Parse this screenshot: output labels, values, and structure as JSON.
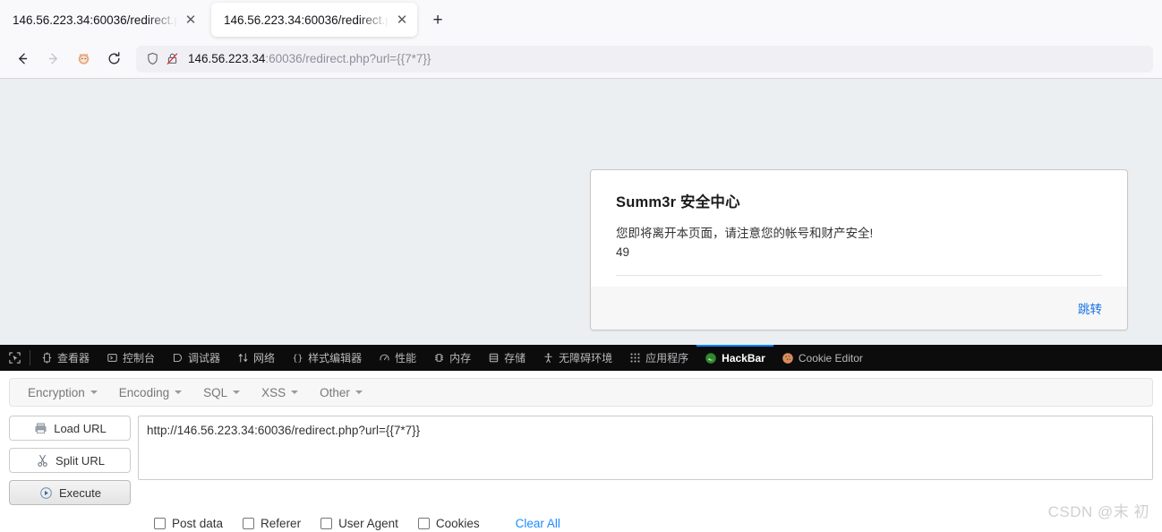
{
  "browser": {
    "tabs": [
      {
        "title": "146.56.223.34:60036/redirect.php",
        "active": false,
        "close": "✕"
      },
      {
        "title": "146.56.223.34:60036/redirect.php",
        "active": true,
        "close": "✕"
      }
    ],
    "newtab_label": "+",
    "nav": {
      "back": "←",
      "forward": "→",
      "home_icon": "fox-home-icon",
      "reload": "↻"
    },
    "urlbar": {
      "shield_icon": "shield-icon",
      "lock_icon": "lock-crossed-icon",
      "url_host": "146.56.223.34",
      "url_rest": ":60036/redirect.php?url={{7*7}}"
    }
  },
  "page": {
    "card": {
      "title": "Summ3r 安全中心",
      "message": "您即将离开本页面，请注意您的帐号和财产安全!",
      "result": "49",
      "link": "跳转"
    },
    "background_color": "#eceff1"
  },
  "devtools": {
    "picker_icon": "element-picker-icon",
    "tabs": [
      {
        "label": "查看器",
        "icon": "inspector-icon",
        "active": false
      },
      {
        "label": "控制台",
        "icon": "console-icon",
        "active": false
      },
      {
        "label": "调试器",
        "icon": "debugger-icon",
        "active": false
      },
      {
        "label": "网络",
        "icon": "network-icon",
        "active": false
      },
      {
        "label": "样式编辑器",
        "icon": "style-editor-icon",
        "active": false
      },
      {
        "label": "性能",
        "icon": "performance-icon",
        "active": false
      },
      {
        "label": "内存",
        "icon": "memory-icon",
        "active": false
      },
      {
        "label": "存储",
        "icon": "storage-icon",
        "active": false
      },
      {
        "label": "无障碍环境",
        "icon": "accessibility-icon",
        "active": false
      },
      {
        "label": "应用程序",
        "icon": "application-icon",
        "active": false
      },
      {
        "label": "HackBar",
        "icon": "hackbar-icon",
        "active": true
      },
      {
        "label": "Cookie Editor",
        "icon": "cookie-icon",
        "active": false
      }
    ],
    "active_tab_accent": "#0b84ff"
  },
  "hackbar": {
    "menus": [
      {
        "label": "Encryption"
      },
      {
        "label": "Encoding"
      },
      {
        "label": "SQL"
      },
      {
        "label": "XSS"
      },
      {
        "label": "Other"
      }
    ],
    "buttons": [
      {
        "label": "Load URL",
        "icon": "load-url-icon"
      },
      {
        "label": "Split URL",
        "icon": "split-url-icon"
      },
      {
        "label": "Execute",
        "icon": "execute-play-icon"
      }
    ],
    "url_value": "http://146.56.223.34:60036/redirect.php?url={{7*7}}",
    "options": [
      {
        "label": "Post data",
        "checked": false
      },
      {
        "label": "Referer",
        "checked": false
      },
      {
        "label": "User Agent",
        "checked": false
      },
      {
        "label": "Cookies",
        "checked": false
      }
    ],
    "clear_all": "Clear All",
    "clear_all_color": "#1a8cff"
  },
  "watermark": "CSDN @末 初"
}
